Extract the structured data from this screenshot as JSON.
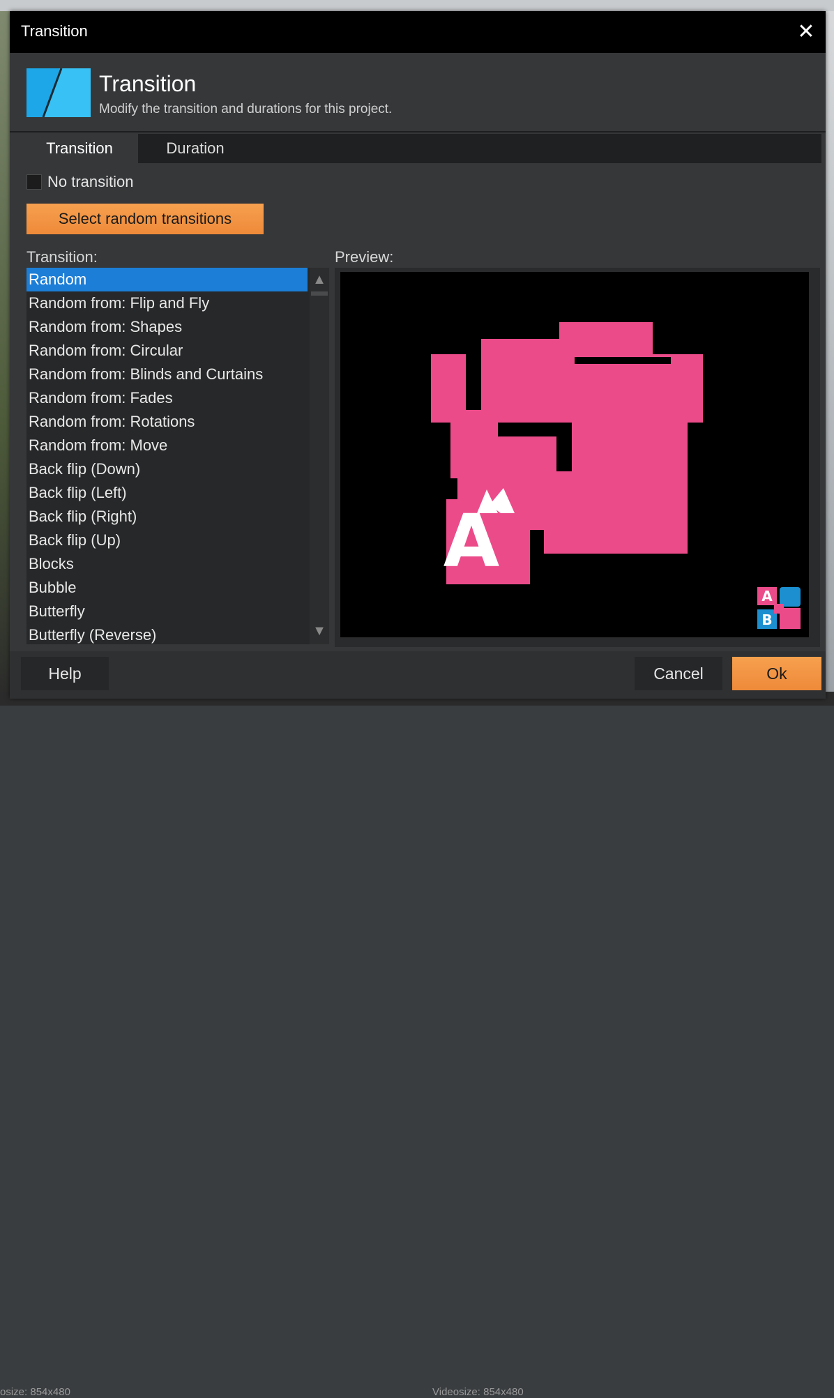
{
  "window": {
    "title": "Transition",
    "close_glyph": "✕"
  },
  "header": {
    "title": "Transition",
    "subtitle": "Modify the transition and durations for this project.",
    "logo_icon": "transition-logo-icon"
  },
  "tabs": [
    {
      "label": "Transition",
      "active": true
    },
    {
      "label": "Duration",
      "active": false
    }
  ],
  "no_transition": {
    "label": "No transition",
    "checked": false
  },
  "random_button": {
    "label": "Select random transitions"
  },
  "transition_list": {
    "label": "Transition:",
    "selected": "Random",
    "items": [
      "Random",
      "Random from: Flip and Fly",
      "Random from: Shapes",
      "Random from: Circular",
      "Random from: Blinds and Curtains",
      "Random from: Fades",
      "Random from: Rotations",
      "Random from: Move",
      "Back flip (Down)",
      "Back flip (Left)",
      "Back flip (Right)",
      "Back flip (Up)",
      "Blocks",
      "Bubble",
      "Butterfly",
      "Butterfly (Reverse)"
    ]
  },
  "preview": {
    "label": "Preview:",
    "badge_a": "A",
    "badge_b": "B",
    "preview_letter": "A"
  },
  "footer": {
    "help": "Help",
    "cancel": "Cancel",
    "ok": "Ok"
  },
  "background": {
    "left_text": "osize: 854x480",
    "right_text": "Videosize: 854x480"
  },
  "colors": {
    "accent_orange": "#f39844",
    "selection_blue": "#1c7ed6",
    "preview_pink": "#ec4b8a",
    "badge_blue": "#1b8fd0"
  }
}
